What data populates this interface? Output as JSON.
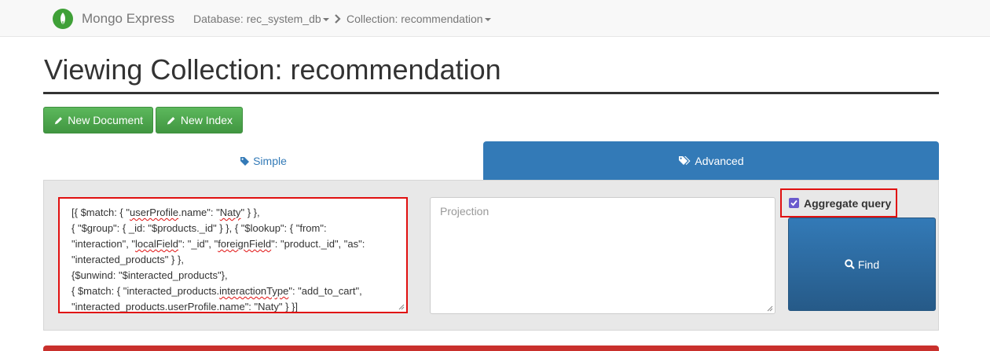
{
  "navbar": {
    "brand": "Mongo Express",
    "database_crumb": "Database: rec_system_db",
    "collection_crumb": "Collection: recommendation"
  },
  "page": {
    "title": "Viewing Collection: recommendation"
  },
  "actions": {
    "new_document": "New Document",
    "new_index": "New Index"
  },
  "tabs": {
    "simple": "Simple",
    "advanced": "Advanced"
  },
  "query": {
    "lines": [
      [
        "[{ $match: { \"",
        {
          "sq": "userProfile"
        },
        ".name\": \"",
        {
          "sq": "Naty"
        },
        "\" } },"
      ],
      [
        "{ \"$group\": { _id: \"$products._id\" } }, { \"$lookup\": { \"from\":"
      ],
      [
        "\"interaction\", \"",
        {
          "sq": "localField"
        },
        "\": \"_id\", \"",
        {
          "sq": "foreignField"
        },
        "\": \"product._id\", \"as\":"
      ],
      [
        "\"interacted_products\" } },"
      ],
      [
        "{$unwind: \"$interacted_products\"},"
      ],
      [
        "{ $match: { \"interacted_products.",
        {
          "sq": "interactionType"
        },
        "\": \"add_to_cart\","
      ],
      [
        "\"interacted_products.",
        {
          "sq": "userProfile"
        },
        ".name\": \"",
        {
          "sq": "Naty"
        },
        "\" } }]"
      ]
    ],
    "projection_placeholder": "Projection",
    "aggregate_label": "Aggregate query",
    "aggregate_checked": true,
    "find_label": "Find"
  },
  "colors": {
    "primary": "#337ab7",
    "success": "#5cb85c",
    "highlight": "#e01010",
    "danger": "#c9302c"
  },
  "icons": [
    "leaf-icon",
    "chevron-right-icon",
    "pencil-icon",
    "tag-icon",
    "tags-icon",
    "search-icon"
  ]
}
